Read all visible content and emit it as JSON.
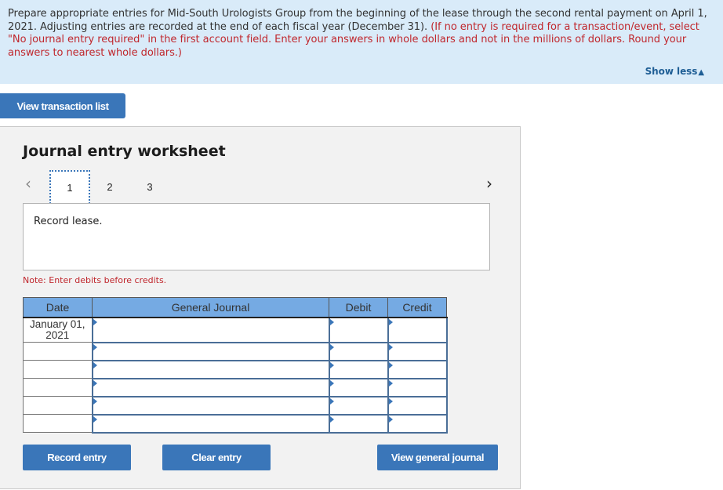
{
  "instructions": {
    "text_main": "Prepare appropriate entries for Mid-South Urologists Group from the beginning of the lease through the second rental payment on April 1, 2021. Adjusting entries are recorded at the end of each fiscal year (December 31). ",
    "text_note": "(If no entry is required for a transaction/event, select \"No journal entry required\" in the first account field. Enter your answers in whole dollars and not in the millions of dollars. Round your answers to nearest whole dollars.)",
    "show_less_label": "Show less",
    "show_less_icon": "▲"
  },
  "buttons": {
    "view_transaction_list": "View transaction list",
    "record_entry": "Record entry",
    "clear_entry": "Clear entry",
    "view_general_journal": "View general journal"
  },
  "worksheet": {
    "title": "Journal entry worksheet",
    "prev_icon": "‹",
    "next_icon": "›",
    "tabs": [
      {
        "label": "1",
        "active": true
      },
      {
        "label": "2",
        "active": false
      },
      {
        "label": "3",
        "active": false
      }
    ],
    "description": "Record lease.",
    "note": "Note: Enter debits before credits."
  },
  "journal": {
    "headers": {
      "date": "Date",
      "general_journal": "General Journal",
      "debit": "Debit",
      "credit": "Credit"
    },
    "rows": [
      {
        "date": "January 01, 2021",
        "account": "",
        "debit": "",
        "credit": ""
      },
      {
        "date": "",
        "account": "",
        "debit": "",
        "credit": ""
      },
      {
        "date": "",
        "account": "",
        "debit": "",
        "credit": ""
      },
      {
        "date": "",
        "account": "",
        "debit": "",
        "credit": ""
      },
      {
        "date": "",
        "account": "",
        "debit": "",
        "credit": ""
      },
      {
        "date": "",
        "account": "",
        "debit": "",
        "credit": ""
      }
    ]
  },
  "colors": {
    "accent_blue": "#3a76b9",
    "header_blue": "#75aae3",
    "instruction_bg": "#d9ebf9",
    "note_red": "#c0272d"
  }
}
